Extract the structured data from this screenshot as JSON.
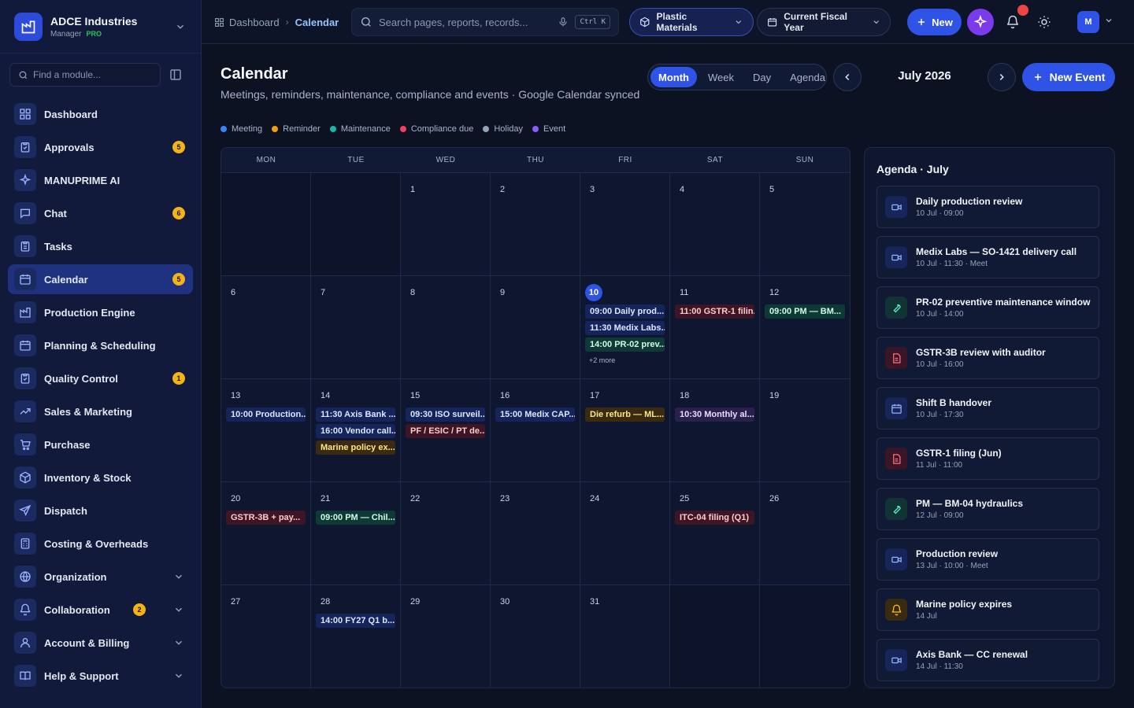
{
  "brand": {
    "name": "ADCE Industries",
    "role": "Manager",
    "tier": "PRO",
    "accent": "#2b4bd8"
  },
  "sidebar": {
    "find_placeholder": "Find a module...",
    "items": [
      {
        "label": "Dashboard",
        "icon": "grid-icon"
      },
      {
        "label": "Approvals",
        "icon": "clipboard-check-icon",
        "badge": "5"
      },
      {
        "label": "MANUPRIME AI",
        "icon": "sparkles-icon"
      },
      {
        "label": "Chat",
        "icon": "message-icon",
        "badge": "6"
      },
      {
        "label": "Tasks",
        "icon": "clipboard-list-icon"
      },
      {
        "label": "Calendar",
        "icon": "calendar-icon",
        "badge": "5",
        "active": true
      },
      {
        "label": "Production Engine",
        "icon": "factory-icon"
      },
      {
        "label": "Planning & Scheduling",
        "icon": "calendar-icon"
      },
      {
        "label": "Quality Control",
        "icon": "clipboard-check-icon",
        "badge": "1"
      },
      {
        "label": "Sales & Marketing",
        "icon": "trend-up-icon"
      },
      {
        "label": "Purchase",
        "icon": "cart-icon"
      },
      {
        "label": "Inventory & Stock",
        "icon": "box-icon"
      },
      {
        "label": "Dispatch",
        "icon": "send-icon"
      },
      {
        "label": "Costing & Overheads",
        "icon": "calculator-icon"
      },
      {
        "label": "Organization",
        "icon": "globe-icon",
        "expandable": true
      },
      {
        "label": "Collaboration",
        "icon": "bell-icon",
        "badge": "2",
        "expandable": true
      },
      {
        "label": "Account & Billing",
        "icon": "user-icon",
        "expandable": true
      },
      {
        "label": "Help & Support",
        "icon": "book-icon",
        "expandable": true
      }
    ]
  },
  "header": {
    "breadcrumb_home": "Dashboard",
    "breadcrumb_current": "Calendar",
    "search_placeholder": "Search pages, reports, records...",
    "shortcut": "Ctrl K",
    "material": "Plastic Materials",
    "fiscal_year": "Current Fiscal Year",
    "new_label": "New",
    "avatar": "M"
  },
  "page": {
    "title": "Calendar",
    "subtitle": "Meetings, reminders, maintenance, compliance and events · Google Calendar synced",
    "views": [
      "Month",
      "Week",
      "Day",
      "Agenda"
    ],
    "active_view": "Month",
    "month_label": "July 2026",
    "new_event_label": "New Event"
  },
  "legend": [
    {
      "label": "Meeting",
      "color": "#3b82f6"
    },
    {
      "label": "Reminder",
      "color": "#f59e0b"
    },
    {
      "label": "Maintenance",
      "color": "#14b8a6"
    },
    {
      "label": "Compliance due",
      "color": "#f43f5e"
    },
    {
      "label": "Holiday",
      "color": "#94a3b8"
    },
    {
      "label": "Event",
      "color": "#8b5cf6"
    }
  ],
  "calendar": {
    "weekdays": [
      "MON",
      "TUE",
      "WED",
      "THU",
      "FRI",
      "SAT",
      "SUN"
    ],
    "cells": [
      {
        "day": ""
      },
      {
        "day": ""
      },
      {
        "day": "1"
      },
      {
        "day": "2"
      },
      {
        "day": "3"
      },
      {
        "day": "4"
      },
      {
        "day": "5"
      },
      {
        "day": "6"
      },
      {
        "day": "7"
      },
      {
        "day": "8"
      },
      {
        "day": "9"
      },
      {
        "day": "10",
        "today": true,
        "events": [
          {
            "text": "09:00 Daily prod...",
            "type": "meeting"
          },
          {
            "text": "11:30 Medix Labs...",
            "type": "meeting"
          },
          {
            "text": "14:00 PR-02 prev...",
            "type": "maintenance"
          }
        ],
        "more": "+2 more"
      },
      {
        "day": "11",
        "events": [
          {
            "text": "11:00 GSTR-1 filin...",
            "type": "compliance"
          }
        ]
      },
      {
        "day": "12",
        "events": [
          {
            "text": "09:00 PM — BM...",
            "type": "maintenance"
          }
        ]
      },
      {
        "day": "13",
        "events": [
          {
            "text": "10:00 Production...",
            "type": "meeting"
          }
        ]
      },
      {
        "day": "14",
        "events": [
          {
            "text": "11:30 Axis Bank ...",
            "type": "meeting"
          },
          {
            "text": "16:00 Vendor call...",
            "type": "meeting"
          },
          {
            "text": "Marine policy ex...",
            "type": "reminder"
          }
        ]
      },
      {
        "day": "15",
        "events": [
          {
            "text": "09:30 ISO surveil...",
            "type": "meeting"
          },
          {
            "text": "PF / ESIC / PT de...",
            "type": "compliance"
          }
        ]
      },
      {
        "day": "16",
        "events": [
          {
            "text": "15:00 Medix CAP...",
            "type": "meeting"
          }
        ]
      },
      {
        "day": "17",
        "events": [
          {
            "text": "Die refurb — ML...",
            "type": "reminder"
          }
        ]
      },
      {
        "day": "18",
        "events": [
          {
            "text": "10:30 Monthly al...",
            "type": "event"
          }
        ]
      },
      {
        "day": "19"
      },
      {
        "day": "20",
        "events": [
          {
            "text": "GSTR-3B + pay...",
            "type": "compliance"
          }
        ]
      },
      {
        "day": "21",
        "events": [
          {
            "text": "09:00 PM — Chil...",
            "type": "maintenance"
          }
        ]
      },
      {
        "day": "22"
      },
      {
        "day": "23"
      },
      {
        "day": "24"
      },
      {
        "day": "25",
        "events": [
          {
            "text": "ITC-04 filing (Q1)",
            "type": "compliance"
          }
        ]
      },
      {
        "day": "26"
      },
      {
        "day": "27"
      },
      {
        "day": "28",
        "events": [
          {
            "text": "14:00 FY27 Q1 b...",
            "type": "meeting"
          }
        ]
      },
      {
        "day": "29"
      },
      {
        "day": "30"
      },
      {
        "day": "31"
      },
      {
        "day": ""
      },
      {
        "day": ""
      }
    ]
  },
  "agenda": {
    "title": "Agenda · July",
    "items": [
      {
        "title": "Daily production review",
        "meta": "10 Jul · 09:00",
        "type": "meeting",
        "icon": "video-icon"
      },
      {
        "title": "Medix Labs — SO-1421 delivery call",
        "meta": "10 Jul · 11:30 · Meet",
        "type": "meeting",
        "icon": "video-icon"
      },
      {
        "title": "PR-02 preventive maintenance window",
        "meta": "10 Jul · 14:00",
        "type": "maintenance",
        "icon": "wrench-icon"
      },
      {
        "title": "GSTR-3B review with auditor",
        "meta": "10 Jul · 16:00",
        "type": "compliance",
        "icon": "document-icon"
      },
      {
        "title": "Shift B handover",
        "meta": "10 Jul · 17:30",
        "type": "meeting",
        "icon": "calendar-icon"
      },
      {
        "title": "GSTR-1 filing (Jun)",
        "meta": "11 Jul · 11:00",
        "type": "compliance",
        "icon": "document-icon"
      },
      {
        "title": "PM — BM-04 hydraulics",
        "meta": "12 Jul · 09:00",
        "type": "maintenance",
        "icon": "wrench-icon"
      },
      {
        "title": "Production review",
        "meta": "13 Jul · 10:00 · Meet",
        "type": "meeting",
        "icon": "video-icon"
      },
      {
        "title": "Marine policy expires",
        "meta": "14 Jul",
        "type": "reminder",
        "icon": "bell-icon"
      },
      {
        "title": "Axis Bank — CC renewal",
        "meta": "14 Jul · 11:30",
        "type": "meeting",
        "icon": "video-icon"
      }
    ]
  }
}
